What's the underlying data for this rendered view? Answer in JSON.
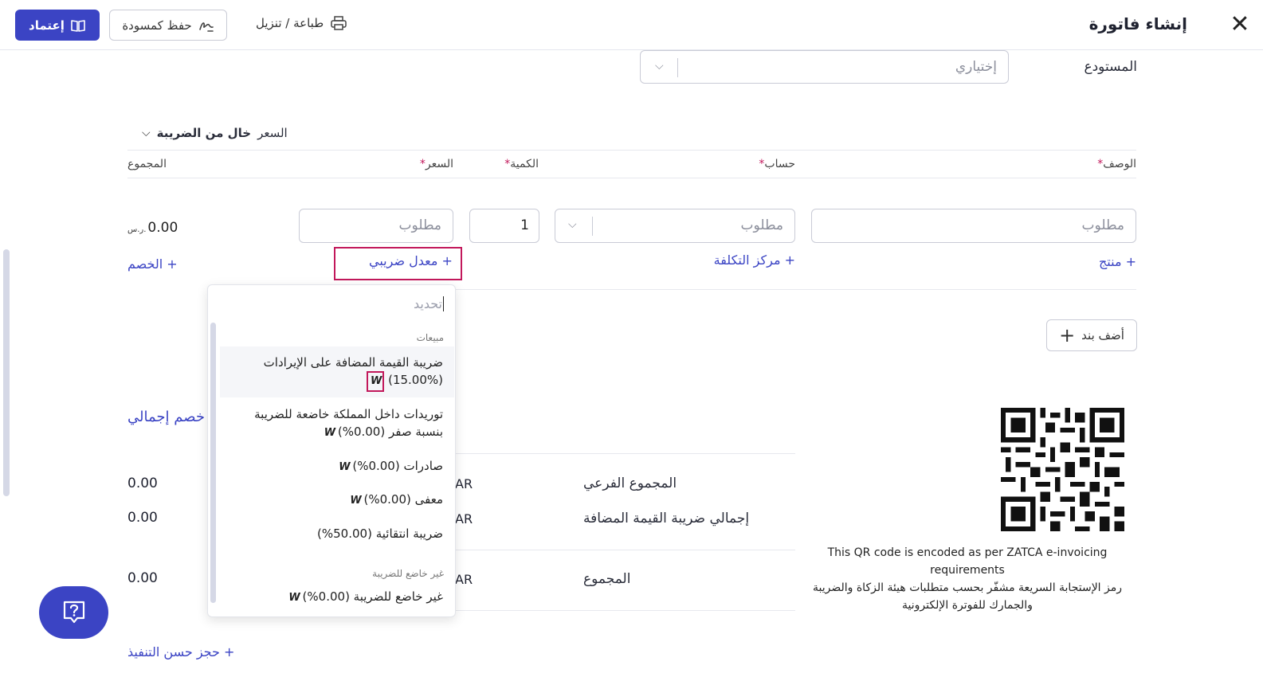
{
  "header": {
    "title": "إنشاء فاتورة",
    "approve_label": "إعتماد",
    "draft_label": "حفظ كمسودة",
    "print_label": "طباعة / تنزيل"
  },
  "warehouse": {
    "label": "المستودع",
    "placeholder": "إختياري"
  },
  "price_mode": {
    "prefix": "السعر",
    "value": "خال من الضريبة"
  },
  "columns": {
    "description": "الوصف",
    "account": "حساب",
    "quantity": "الكمية",
    "price": "السعر",
    "total": "المجموع",
    "required_mark": "*"
  },
  "line_item": {
    "description_placeholder": "مطلوب",
    "account_placeholder": "مطلوب",
    "quantity": "1",
    "price_placeholder": "مطلوب",
    "total": "0.00",
    "currency": "ر.س."
  },
  "line_links": {
    "product": "+ منتج",
    "cost_center": "+ مركز التكلفة",
    "tax_rate": "+ معدل ضريبي",
    "discount": "+ الخصم"
  },
  "tax_dropdown": {
    "search_placeholder": "تحديد",
    "group_sales": "مبيعات",
    "items": [
      {
        "line1": "ضريبة القيمة المضافة على الإيرادات",
        "line2": "(15.00%)"
      },
      {
        "line1": "توريدات داخل المملكة خاضعة للضريبة",
        "line2": "بنسبة صفر (0.00%)"
      },
      {
        "line1": "صادرات (0.00%)"
      },
      {
        "line1": "معفى (0.00%)"
      },
      {
        "line1": "ضريبة انتقائية (50.00%)"
      }
    ],
    "group_non_taxable": "غير خاضع للضريبة",
    "non_taxable_item": "غير خاضع للضريبة (0.00%)",
    "icon_glyph": "W"
  },
  "add_line_label": "أضف بند",
  "overall_discount_label": "خصم إجمالي",
  "summary": {
    "subtotal_label": "المجموع الفرعي",
    "subtotal_value": "0.00",
    "vat_label": "إجمالي ضريبة القيمة المضافة",
    "vat_value": "0.00",
    "total_label": "المجموع",
    "total_value": "0.00",
    "currency_partial": "AR"
  },
  "retention_label": "+ حجز حسن التنفيذ",
  "qr_note": {
    "en": "This QR code is encoded as per ZATCA e-invoicing requirements",
    "ar": "رمز الإستجابة السريعة مشفّر بحسب متطلبات هيئة الزكاة والضريبة والجمارك للفوترة الإلكترونية"
  },
  "colors": {
    "primary": "#3b44c4",
    "highlight": "#c2185b"
  }
}
